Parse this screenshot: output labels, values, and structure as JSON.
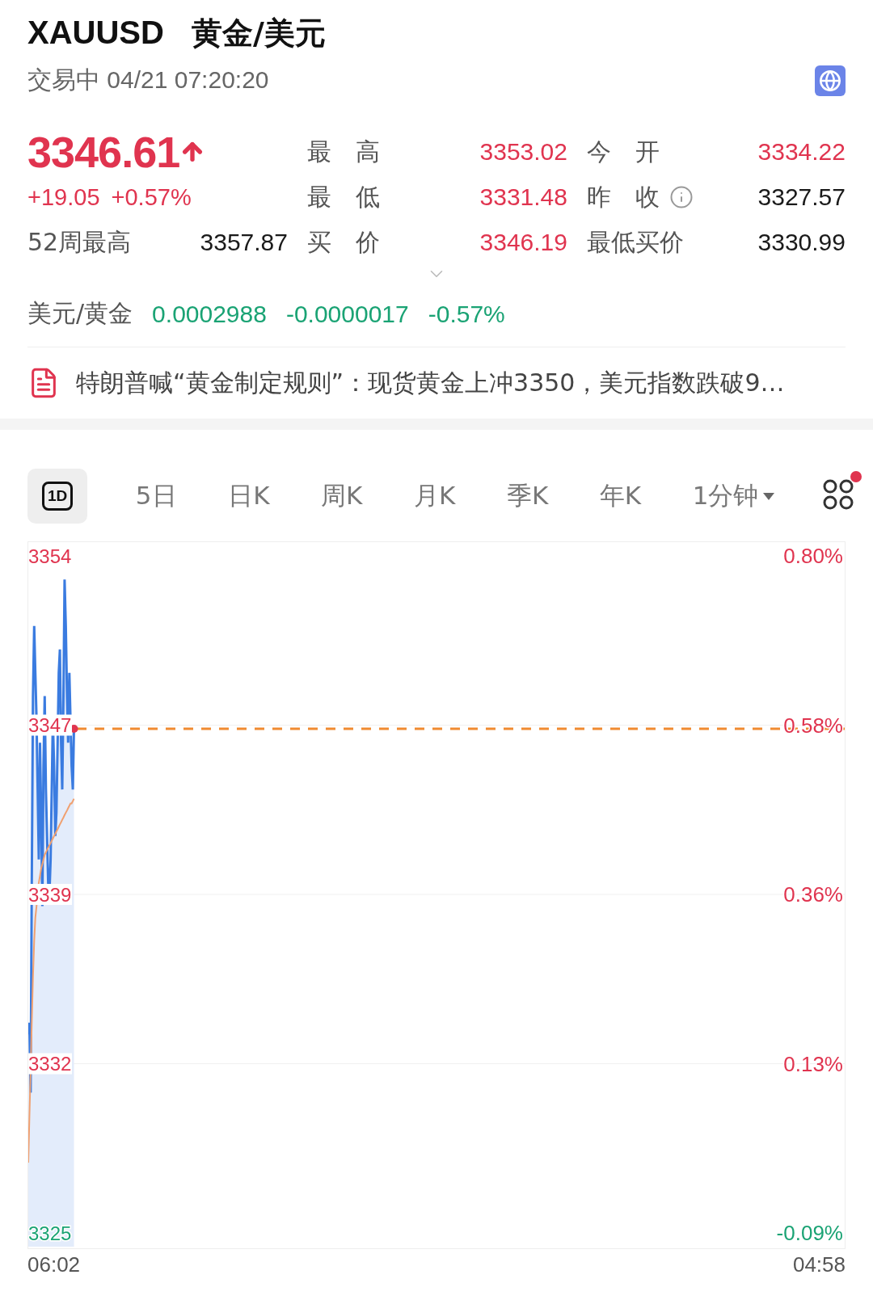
{
  "header": {
    "symbol": "XAUUSD",
    "name": "黄金/美元",
    "status": "交易中 04/21 07:20:20"
  },
  "quote": {
    "price": "3346.61",
    "rising": true,
    "change": "+19.05",
    "change_pct": "+0.57%"
  },
  "week52": {
    "label": "52周最高",
    "value": "3357.87"
  },
  "stats": [
    {
      "label": "最　高",
      "value": "3353.02",
      "color": "#e0344f",
      "info": false
    },
    {
      "label": "今　开",
      "value": "3334.22",
      "color": "#e0344f",
      "info": false
    },
    {
      "label": "最　低",
      "value": "3331.48",
      "color": "#e0344f",
      "info": false
    },
    {
      "label": "昨　收",
      "value": "3327.57",
      "color": "#1a1a1a",
      "info": true
    },
    {
      "label": "买　价",
      "value": "3346.19",
      "color": "#e0344f",
      "info": false
    },
    {
      "label": "最低买价",
      "value": "3330.99",
      "color": "#1a1a1a",
      "info": false
    }
  ],
  "inverse": {
    "label": "美元/黄金",
    "price": "0.0002988",
    "change": "-0.0000017",
    "change_pct": "-0.57%",
    "falling": true
  },
  "news": {
    "headline": "特朗普喊“黄金制定规则”：现货黄金上冲3350，美元指数跌破9…"
  },
  "tabs": [
    {
      "label": "1D",
      "kind": "badge",
      "selected": true
    },
    {
      "label": "5日",
      "kind": "text",
      "selected": false
    },
    {
      "label": "日K",
      "kind": "text",
      "selected": false
    },
    {
      "label": "周K",
      "kind": "text",
      "selected": false
    },
    {
      "label": "月K",
      "kind": "text",
      "selected": false
    },
    {
      "label": "季K",
      "kind": "text",
      "selected": false
    },
    {
      "label": "年K",
      "kind": "text",
      "selected": false
    },
    {
      "label": "1分钟",
      "kind": "text",
      "selected": false,
      "dropdown": true
    }
  ],
  "more": {
    "notification": true
  },
  "chart": {
    "price_labels": [
      {
        "label": "3354",
        "color": "#e0344f"
      },
      {
        "label": "3347",
        "color": "#e0344f"
      },
      {
        "label": "3339",
        "color": "#e0344f"
      },
      {
        "label": "3332",
        "color": "#e0344f"
      },
      {
        "label": "3325",
        "color": "#1aa374"
      }
    ],
    "pct_labels": [
      {
        "label": "0.80%",
        "color": "#e0344f"
      },
      {
        "label": "0.58%",
        "color": "#e0344f"
      },
      {
        "label": "0.36%",
        "color": "#e0344f"
      },
      {
        "label": "0.13%",
        "color": "#e0344f"
      },
      {
        "label": "-0.09%",
        "color": "#1aa374"
      }
    ],
    "time_labels": [
      "06:02",
      "04:58"
    ]
  }
}
